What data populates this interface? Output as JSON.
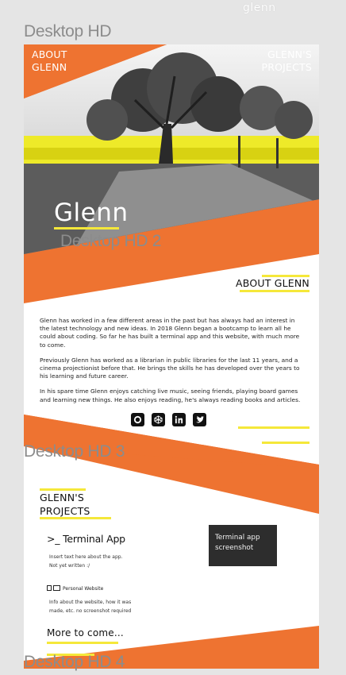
{
  "top_logo": "glenn",
  "frames": [
    {
      "label": "Desktop HD"
    },
    {
      "label": "Desktop HD 2"
    },
    {
      "label": "Desktop HD 3"
    },
    {
      "label": "Desktop HD 4"
    }
  ],
  "nav": {
    "about": [
      "ABOUT",
      "GLENN"
    ],
    "projects": [
      "GLENN'S",
      "PROJECTS"
    ]
  },
  "hero": {
    "title": "Glenn"
  },
  "about": {
    "heading": "ABOUT GLENN",
    "paragraphs": [
      "Glenn has worked in a few different areas in the past but has always had an interest in the latest technology and new ideas. In 2018 Glenn began a bootcamp to learn all he could about coding. So far he has built a terminal app and this website, with much more to come.",
      "Previously Glenn has worked as a librarian in public libraries for the last 11 years, and a cinema projectionist before that. He brings the skills he has developed over the years to his learning and future career.",
      "In his spare time Glenn enjoys catching live music, seeing friends, playing board games and learning new things. He also enjoys reading, he's always reading books and articles."
    ],
    "social_icons": [
      "github-icon",
      "codepen-icon",
      "linkedin-icon",
      "twitter-icon"
    ]
  },
  "projects": {
    "heading": [
      "GLENN'S",
      "PROJECTS"
    ],
    "terminal_title": ">_ Terminal App",
    "terminal_desc": [
      "Insert text here about the app.",
      "Not yet written :/"
    ],
    "screenshot_label": [
      "Terminal app",
      "screenshot"
    ],
    "website_label": "Personal Website",
    "website_desc": [
      "Info about the website, how it was",
      "made, etc. no screenshot required"
    ],
    "more": "More to come..."
  },
  "colors": {
    "accent": "#ee7331",
    "highlight": "#f5e83a"
  }
}
